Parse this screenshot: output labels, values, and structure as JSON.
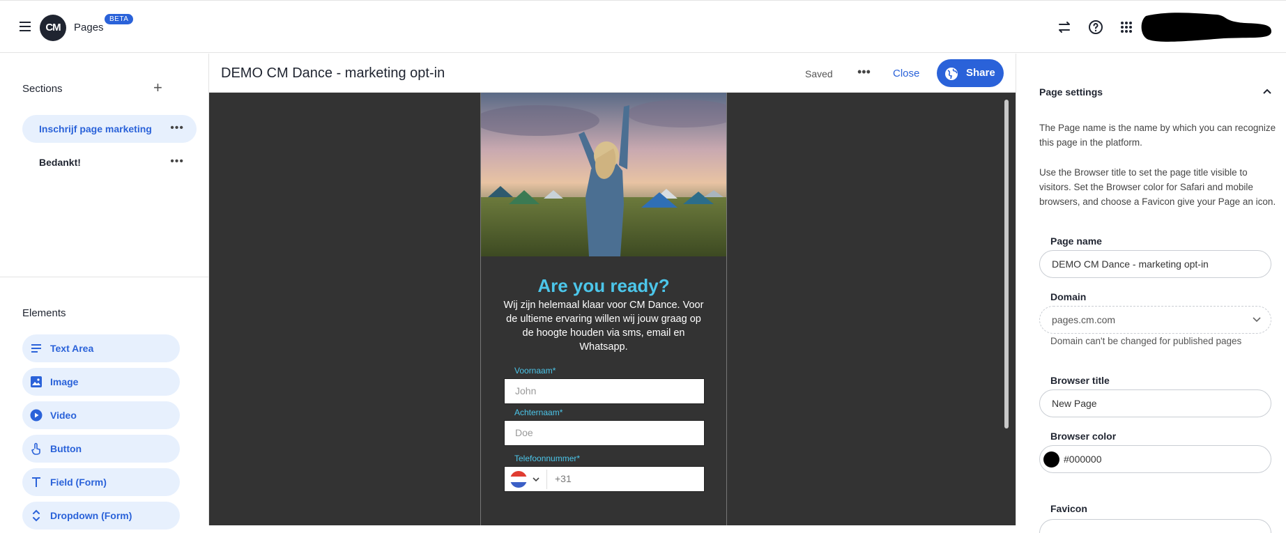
{
  "topbar": {
    "app_name": "Pages",
    "badge": "BETA",
    "logo_text": "CM",
    "icons": [
      "menu-icon",
      "switch-arrows-icon",
      "help-icon",
      "apps-grid-icon"
    ]
  },
  "sections": {
    "title": "Sections",
    "items": [
      {
        "label": "Inschrijf page marketing",
        "active": true
      },
      {
        "label": "Bedankt!",
        "active": false
      }
    ]
  },
  "elements": {
    "title": "Elements",
    "items": [
      {
        "label": "Text Area",
        "icon": "text-lines-icon"
      },
      {
        "label": "Image",
        "icon": "image-icon"
      },
      {
        "label": "Video",
        "icon": "play-circle-icon"
      },
      {
        "label": "Button",
        "icon": "pointer-hand-icon"
      },
      {
        "label": "Field (Form)",
        "icon": "text-field-icon"
      },
      {
        "label": "Dropdown (Form)",
        "icon": "dropdown-arrows-icon"
      }
    ]
  },
  "editor": {
    "title": "DEMO CM Dance - marketing opt-in",
    "status": "Saved",
    "close_label": "Close",
    "share_label": "Share"
  },
  "preview": {
    "heading": "Are you ready?",
    "body": "Wij zijn helemaal klaar voor CM Dance. Voor de ultieme ervaring willen wij jouw graag op de hoogte houden via sms, email en Whatsapp.",
    "fields": [
      {
        "label": "Voornaam*",
        "placeholder": "John"
      },
      {
        "label": "Achternaam*",
        "placeholder": "Doe"
      },
      {
        "label": "Telefoonnummer*",
        "placeholder": "+31"
      }
    ]
  },
  "settings": {
    "title": "Page settings",
    "desc1": "The Page name is the name by which you can recognize this page in the platform.",
    "desc2": "Use the Browser title to set the page title visible to visitors. Set the Browser color for Safari and mobile browsers, and choose a Favicon give your Page an icon.",
    "page_name_label": "Page name",
    "page_name_value": "DEMO CM Dance - marketing opt-in",
    "domain_label": "Domain",
    "domain_value": "pages.cm.com",
    "domain_note": "Domain can't be changed for published pages",
    "browser_title_label": "Browser title",
    "browser_title_value": "New Page",
    "browser_color_label": "Browser color",
    "browser_color_value": "#000000",
    "favicon_label": "Favicon"
  },
  "colors": {
    "accent": "#2a62d9",
    "accent_light": "#e7f0fd",
    "preview_heading": "#4cc6ea",
    "canvas_bg": "#333333"
  }
}
